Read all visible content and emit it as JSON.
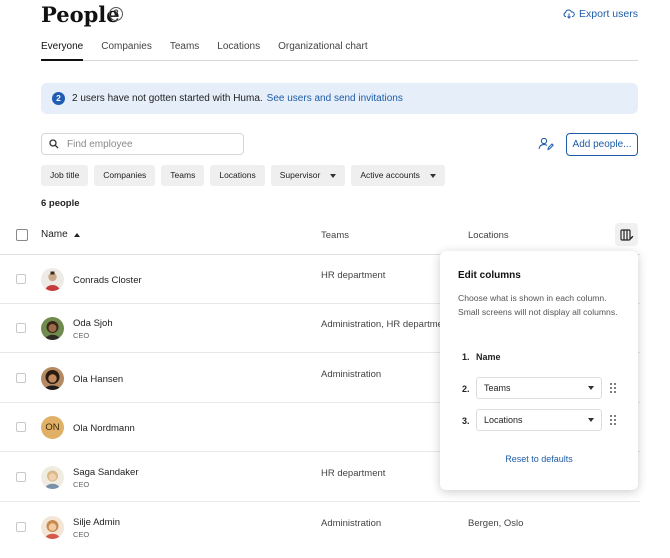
{
  "page": {
    "title": "People",
    "help_icon": "question-circle-icon",
    "export_label": "Export users",
    "export_icon": "cloud-download-icon"
  },
  "tabs": [
    "Everyone",
    "Companies",
    "Teams",
    "Locations",
    "Organizational chart"
  ],
  "active_tab": "Everyone",
  "banner": {
    "icon_text": "2",
    "text": "2 users have not gotten started with Huma.",
    "link": "See users and send invitations"
  },
  "search": {
    "placeholder": "Find employee"
  },
  "add_button": "Add people...",
  "filters": [
    {
      "label": "Job title",
      "dropdown": false
    },
    {
      "label": "Companies",
      "dropdown": false
    },
    {
      "label": "Teams",
      "dropdown": false
    },
    {
      "label": "Locations",
      "dropdown": false
    },
    {
      "label": "Supervisor",
      "dropdown": true
    },
    {
      "label": "Active accounts",
      "dropdown": true
    }
  ],
  "count": "6 people",
  "table": {
    "headers": {
      "name": "Name",
      "teams": "Teams",
      "locations": "Locations"
    },
    "rows": [
      {
        "name": "Conrads Closter",
        "role": "",
        "teams": "HR department",
        "locations": "",
        "avatar": {
          "kind": "photo",
          "color": "#c9a98a"
        }
      },
      {
        "name": "Oda Sjoh",
        "role": "CEO",
        "teams": "Administration, HR department",
        "locations": "",
        "avatar": {
          "kind": "photo",
          "color": "#5b4232"
        }
      },
      {
        "name": "Ola Hansen",
        "role": "",
        "teams": "Administration",
        "locations": "",
        "avatar": {
          "kind": "photo",
          "color": "#7a4a2a"
        }
      },
      {
        "name": "Ola Nordmann",
        "role": "",
        "teams": "",
        "locations": "",
        "avatar": {
          "kind": "initials",
          "text": "ON",
          "color": "#e0b066"
        }
      },
      {
        "name": "Saga Sandaker",
        "role": "CEO",
        "teams": "HR department",
        "locations": "",
        "avatar": {
          "kind": "photo",
          "color": "#d7c7a0"
        }
      },
      {
        "name": "Silje Admin",
        "role": "CEO",
        "teams": "Administration",
        "locations": "Bergen, Oslo",
        "avatar": {
          "kind": "photo",
          "color": "#e0b890"
        }
      }
    ]
  },
  "edit_columns": {
    "title": "Edit columns",
    "description": "Choose what is shown in each column. Small screens will not display all columns.",
    "columns": [
      {
        "num": "1.",
        "label": "Name",
        "editable": false
      },
      {
        "num": "2.",
        "label": "Teams",
        "editable": true
      },
      {
        "num": "3.",
        "label": "Locations",
        "editable": true
      }
    ],
    "reset": "Reset to defaults"
  },
  "colors": {
    "accent": "#1d5ca8",
    "banner_bg": "#e6eef9",
    "chip_bg": "#efefef"
  }
}
